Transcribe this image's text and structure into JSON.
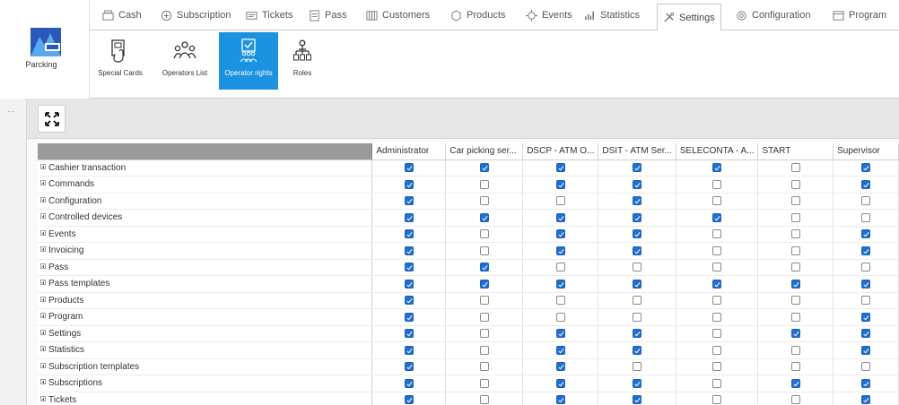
{
  "app": {
    "name": "Parcking"
  },
  "tabs": [
    {
      "label": "Cash",
      "icon": "cash-icon",
      "active": false
    },
    {
      "label": "Subscription",
      "icon": "subscription-icon",
      "active": false
    },
    {
      "label": "Tickets",
      "icon": "tickets-icon",
      "active": false
    },
    {
      "label": "Pass",
      "icon": "pass-icon",
      "active": false
    },
    {
      "label": "Customers",
      "icon": "customers-icon",
      "active": false
    },
    {
      "label": "Products",
      "icon": "products-icon",
      "active": false
    },
    {
      "label": "Events",
      "icon": "events-icon",
      "active": false
    },
    {
      "label": "Statistics",
      "icon": "statistics-icon",
      "active": false
    },
    {
      "label": "Settings",
      "icon": "settings-icon",
      "active": true
    },
    {
      "label": "Configuration",
      "icon": "configuration-icon",
      "active": false
    },
    {
      "label": "Program",
      "icon": "program-icon",
      "active": false
    }
  ],
  "ribbon": [
    {
      "label": "Special Cards",
      "icon": "special-cards-icon",
      "active": false
    },
    {
      "label": "Operators List",
      "icon": "operators-list-icon",
      "active": false
    },
    {
      "label": "Operator rights",
      "icon": "operator-rights-icon",
      "active": true
    },
    {
      "label": "Roles",
      "icon": "roles-icon",
      "active": false
    }
  ],
  "toolbar": {
    "expand_icon": "expand-icon",
    "sidebar_collapse": "···"
  },
  "grid": {
    "columns": [
      "Administrator",
      "Car picking ser...",
      "DSCP - ATM O...",
      "DSIT - ATM Ser...",
      "SELECONTA - A...",
      "START",
      "Supervisor"
    ],
    "rows": [
      {
        "label": "Cashier transaction",
        "values": [
          true,
          true,
          true,
          true,
          true,
          false,
          true
        ]
      },
      {
        "label": "Commands",
        "values": [
          true,
          false,
          true,
          true,
          false,
          false,
          true
        ]
      },
      {
        "label": "Configuration",
        "values": [
          true,
          false,
          false,
          true,
          false,
          false,
          false
        ]
      },
      {
        "label": "Controlled devices",
        "values": [
          true,
          true,
          true,
          true,
          true,
          false,
          false
        ]
      },
      {
        "label": "Events",
        "values": [
          true,
          false,
          true,
          true,
          false,
          false,
          true
        ]
      },
      {
        "label": "Invoicing",
        "values": [
          true,
          false,
          true,
          true,
          false,
          false,
          true
        ]
      },
      {
        "label": "Pass",
        "values": [
          true,
          true,
          false,
          false,
          false,
          false,
          false
        ]
      },
      {
        "label": "Pass templates",
        "values": [
          true,
          true,
          true,
          true,
          true,
          true,
          true
        ]
      },
      {
        "label": "Products",
        "values": [
          true,
          false,
          false,
          false,
          false,
          false,
          false
        ]
      },
      {
        "label": "Program",
        "values": [
          true,
          false,
          false,
          false,
          false,
          false,
          true
        ]
      },
      {
        "label": "Settings",
        "values": [
          true,
          false,
          true,
          true,
          false,
          true,
          true
        ]
      },
      {
        "label": "Statistics",
        "values": [
          true,
          false,
          true,
          true,
          false,
          false,
          true
        ]
      },
      {
        "label": "Subscription templates",
        "values": [
          true,
          false,
          true,
          false,
          false,
          false,
          false
        ]
      },
      {
        "label": "Subscriptions",
        "values": [
          true,
          false,
          true,
          true,
          false,
          true,
          true
        ]
      },
      {
        "label": "Tickets",
        "values": [
          true,
          false,
          true,
          true,
          false,
          false,
          true
        ]
      }
    ]
  },
  "colors": {
    "accent": "#1b93e0",
    "checked": "#1f6fd0"
  }
}
